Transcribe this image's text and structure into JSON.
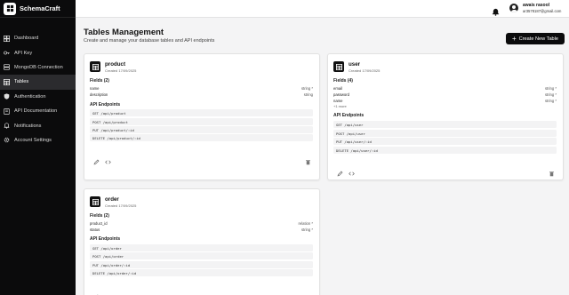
{
  "app": {
    "name": "SchemaCraft"
  },
  "sidebar": {
    "items": [
      {
        "label": "Dashboard",
        "icon": "dashboard-icon",
        "active": false
      },
      {
        "label": "API Key",
        "icon": "key-icon",
        "active": false
      },
      {
        "label": "MongoDB Connection",
        "icon": "database-icon",
        "active": false
      },
      {
        "label": "Tables",
        "icon": "table-icon",
        "active": true
      },
      {
        "label": "Authentication",
        "icon": "shield-icon",
        "active": false
      },
      {
        "label": "API Documentation",
        "icon": "book-icon",
        "active": false
      },
      {
        "label": "Notifications",
        "icon": "bell-icon",
        "active": false
      },
      {
        "label": "Account Settings",
        "icon": "gear-icon",
        "active": false
      }
    ]
  },
  "topbar": {
    "user_name": "awais rasool",
    "user_email": "ar3578187@gmail.com"
  },
  "header": {
    "title": "Tables Management",
    "subtitle": "Create and manage your database tables and API endpoints",
    "create_button": "Create New Table"
  },
  "cards": [
    {
      "name": "product",
      "created": "Created 17/09/2025",
      "fields_heading": "Fields (2)",
      "fields": [
        {
          "name": "name",
          "type": "string *"
        },
        {
          "name": "description",
          "type": "string"
        }
      ],
      "more": "",
      "api_heading": "API Endpoints",
      "endpoints": [
        "GET /api/product",
        "POST /api/product",
        "PUT /api/product/:id",
        "DELETE /api/product/:id"
      ]
    },
    {
      "name": "user",
      "created": "Created 17/09/2025",
      "fields_heading": "Fields (4)",
      "fields": [
        {
          "name": "email",
          "type": "string *"
        },
        {
          "name": "password",
          "type": "string *"
        },
        {
          "name": "name",
          "type": "string *"
        }
      ],
      "more": "+1 more",
      "api_heading": "API Endpoints",
      "endpoints": [
        "GET /api/user",
        "POST /api/user",
        "PUT /api/user/:id",
        "DELETE /api/user/:id"
      ]
    },
    {
      "name": "order",
      "created": "Created 17/09/2025",
      "fields_heading": "Fields (2)",
      "fields": [
        {
          "name": "product_id",
          "type": "relation *"
        },
        {
          "name": "status",
          "type": "string *"
        }
      ],
      "more": "",
      "api_heading": "API Endpoints",
      "endpoints": [
        "GET /api/order",
        "POST /api/order",
        "PUT /api/order/:id",
        "DELETE /api/order/:id"
      ]
    }
  ],
  "colors": {
    "sidebar_bg": "#0b0b0c",
    "active_item": "#2b2b2e",
    "page_bg": "#f4f4f5",
    "primary_button": "#0b0b0c"
  }
}
